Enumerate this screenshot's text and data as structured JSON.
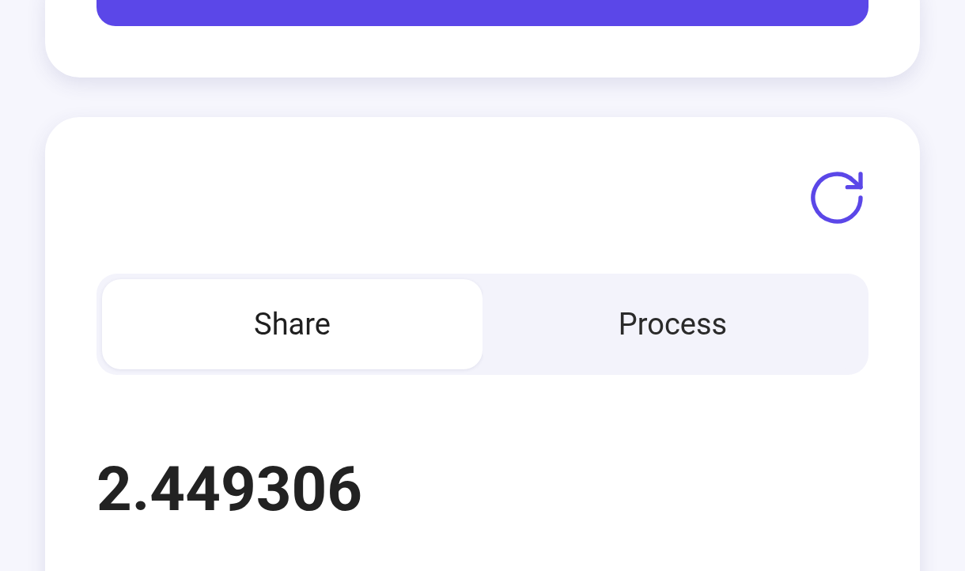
{
  "tabs": [
    {
      "label": "Share",
      "selected": true
    },
    {
      "label": "Process",
      "selected": false
    }
  ],
  "value": "2.449306"
}
